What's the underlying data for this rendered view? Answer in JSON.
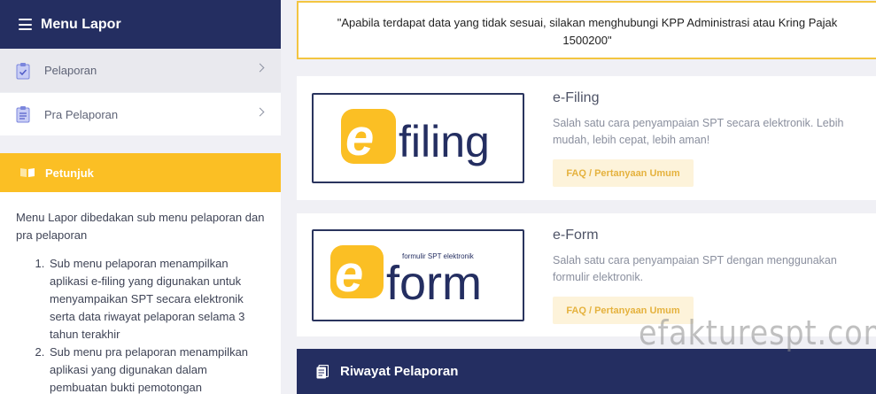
{
  "sidebar": {
    "menu_title": "Menu Lapor",
    "items": [
      {
        "label": "Pelaporan",
        "icon": "clipboard-check-icon"
      },
      {
        "label": "Pra Pelaporan",
        "icon": "clipboard-list-icon"
      }
    ]
  },
  "petunjuk": {
    "title": "Petunjuk",
    "intro": "Menu Lapor dibedakan sub menu pelaporan dan pra pelaporan",
    "steps": [
      "Sub menu pelaporan menampilkan aplikasi e-filing yang digunakan untuk menyampaikan SPT secara elektronik serta data riwayat pelaporan selama 3 tahun terakhir",
      "Sub menu pra pelaporan menampilkan aplikasi yang digunakan dalam pembuatan bukti pemotongan"
    ]
  },
  "notice": {
    "text": "\"Apabila terdapat data yang tidak sesuai, silakan menghubungi KPP Administrasi atau Kring Pajak 1500200\""
  },
  "services": [
    {
      "title": "e-Filing",
      "logo_text": "filing",
      "description": "Salah satu cara penyampaian SPT secara elektronik. Lebih mudah, lebih cepat, lebih aman!",
      "faq_label": "FAQ / Pertanyaan Umum"
    },
    {
      "title": "e-Form",
      "logo_text": "form",
      "logo_tagline": "formulir SPT elektronik",
      "description": "Salah satu cara penyampaian SPT dengan menggunakan formulir elektronik.",
      "faq_label": "FAQ / Pertanyaan Umum"
    }
  ],
  "riwayat": {
    "title": "Riwayat Pelaporan"
  },
  "watermark": "efakturespt.com",
  "colors": {
    "navy": "#242e61",
    "yellow": "#fbbf24",
    "faq_bg": "#fdf3da",
    "faq_text": "#e5b23e"
  }
}
